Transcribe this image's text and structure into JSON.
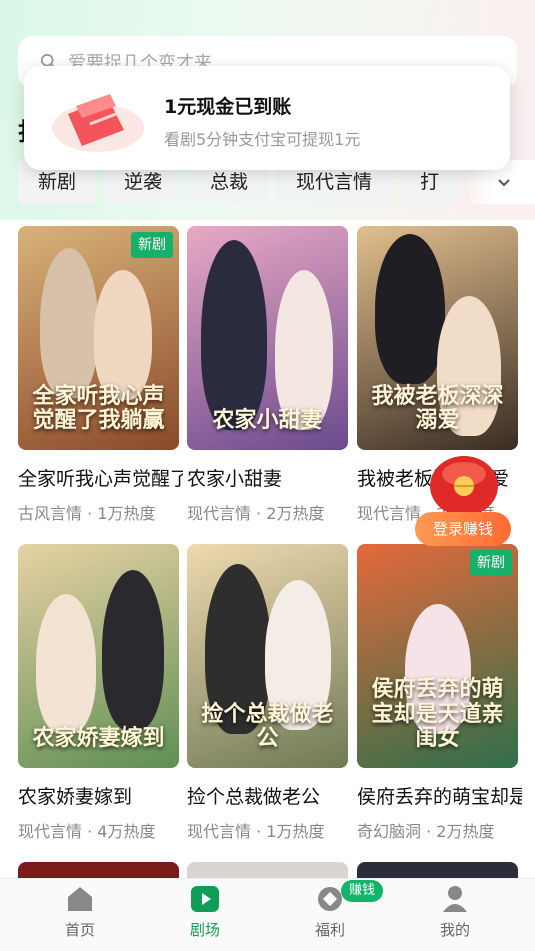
{
  "search": {
    "placeholder": "爱要捉几个变才来"
  },
  "section": {
    "title": "打"
  },
  "toast": {
    "title": "1元现金已到账",
    "subtitle": "看剧5分钟支付宝可提现1元"
  },
  "tags": [
    "新剧",
    "逆袭",
    "总裁",
    "现代言情",
    "打"
  ],
  "dramas": [
    {
      "name": "全家听我心声觉醒了",
      "meta": "古风言情 · 1万热度",
      "badge": "新剧",
      "poster_text": "全家听我心声觉醒了我躺赢",
      "color_a": "#8a4a2a",
      "color_b": "#d9b27a"
    },
    {
      "name": "农家小甜妻",
      "meta": "现代言情 · 2万热度",
      "badge": "",
      "poster_text": "农家小甜妻",
      "color_a": "#6b4a8f",
      "color_b": "#e9a9c4"
    },
    {
      "name": "我被老板深深溺爱",
      "meta": "现代言情 · 2万热度",
      "badge": "",
      "poster_text": "我被老板深深溺爱",
      "color_a": "#3a2c24",
      "color_b": "#e2c08e"
    },
    {
      "name": "农家娇妻嫁到",
      "meta": "现代言情 · 4万热度",
      "badge": "",
      "poster_text": "农家娇妻嫁到",
      "color_a": "#5f8f54",
      "color_b": "#e7d2a4"
    },
    {
      "name": "捡个总裁做老公",
      "meta": "现代言情 · 1万热度",
      "badge": "",
      "poster_text": "捡个总裁做老公",
      "color_a": "#6f7a55",
      "color_b": "#efd9b0"
    },
    {
      "name": "侯府丢弃的萌宝却是天道亲闺女",
      "meta": "奇幻脑洞 · 2万热度",
      "badge": "新剧",
      "poster_text": "侯府丢弃的萌宝却是天道亲闺女",
      "color_a": "#2f6f4a",
      "color_b": "#e46a3b"
    }
  ],
  "reward": {
    "label": "登录赚钱"
  },
  "nav": {
    "home": "首页",
    "theater": "剧场",
    "welfare": "福利",
    "earn_badge": "赚钱",
    "mine": "我的"
  },
  "colors": {
    "accent": "#0f9d58",
    "badge": "#17b06a",
    "reward": "#ff6a32"
  }
}
